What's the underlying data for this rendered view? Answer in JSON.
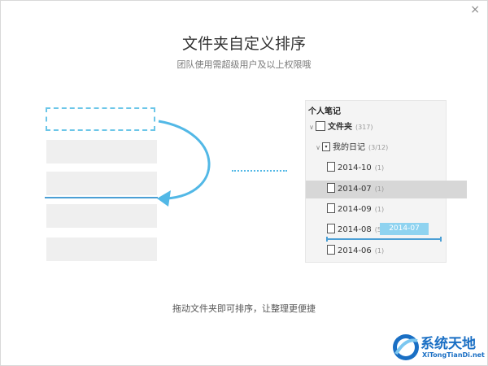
{
  "dialog": {
    "close_glyph": "×",
    "title": "文件夹自定义排序",
    "subtitle": "团队使用需超级用户及以上权限哦",
    "footer": "拖动文件夹即可排序，让整理更便捷"
  },
  "tree": {
    "header": "个人笔记",
    "root": {
      "label": "文件夹",
      "count": "(317)"
    },
    "group": {
      "label": "我的日记",
      "count": "(3/12)"
    },
    "items": [
      {
        "label": "2014-10",
        "count": "(1)"
      },
      {
        "label": "2014-07",
        "count": "(1)"
      },
      {
        "label": "2014-09",
        "count": "(1)"
      },
      {
        "label": "2014-08",
        "count": "(5)"
      },
      {
        "label": "2014-06",
        "count": "(1)"
      }
    ],
    "dragging_label": "2014-07"
  },
  "watermark": {
    "title": "系统天地",
    "url": "XiTongTianDi.net"
  },
  "colors": {
    "accent": "#4b9fd5",
    "arrow": "#52b8e6",
    "drag_chip": "#8fd3f0",
    "selected_row": "#d7d7d7",
    "watermark": "#1a6fc4"
  }
}
